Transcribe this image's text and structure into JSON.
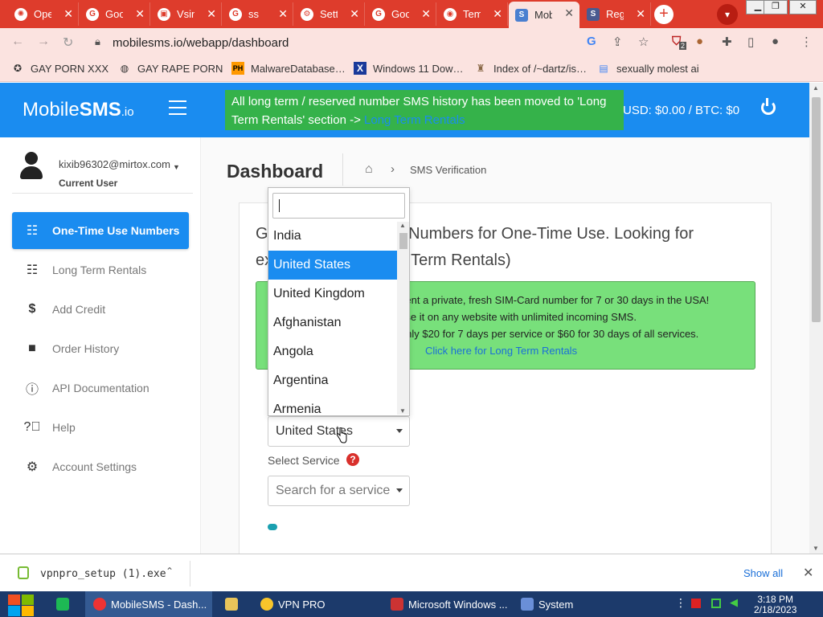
{
  "browser": {
    "tabs": [
      {
        "title": "Ope",
        "icon": "openai-icon"
      },
      {
        "title": "Goo",
        "icon": "google-icon"
      },
      {
        "title": "Vsin",
        "icon": "sim-icon"
      },
      {
        "title": "ss",
        "icon": "google-icon"
      },
      {
        "title": "Sett",
        "icon": "gear-icon"
      },
      {
        "title": "Goo",
        "icon": "google-icon"
      },
      {
        "title": "Tem",
        "icon": "globe-icon"
      },
      {
        "title": "Mob",
        "icon": "sms-icon"
      },
      {
        "title": "Reg",
        "icon": "sms-icon"
      }
    ],
    "active_tab_index": 7,
    "url": "mobilesms.io/webapp/dashboard",
    "extension_badge": "2",
    "bookmarks": [
      {
        "label": "GAY PORN XXX"
      },
      {
        "label": "GAY RAPE PORN"
      },
      {
        "label": "MalwareDatabase…",
        "icon_text": "PH"
      },
      {
        "label": "Windows 11 Dow…",
        "icon_text": "X"
      },
      {
        "label": "Index of /~dartz/is…"
      },
      {
        "label": "sexually molest ai"
      }
    ]
  },
  "app": {
    "logo_prefix": "Mobile",
    "logo_bold": "SMS",
    "logo_suffix": ".io",
    "notice_text": "All long term / reserved number SMS history has been moved to 'Long Term Rentals' section ->",
    "notice_link": "Long Term Rentals",
    "balance": "USD: $0.00  /  BTC: $0",
    "user": {
      "email": "kixib96302@mirtox.com",
      "role": "Current User"
    },
    "nav": [
      {
        "label": "One-Time Use Numbers",
        "icon": "list-check-icon",
        "active": true
      },
      {
        "label": "Long Term Rentals",
        "icon": "list-check-icon",
        "active": false
      },
      {
        "label": "Add Credit",
        "icon": "dollar-icon",
        "active": false
      },
      {
        "label": "Order History",
        "icon": "note-icon",
        "active": false
      },
      {
        "label": "API Documentation",
        "icon": "info-icon",
        "active": false
      },
      {
        "label": "Help",
        "icon": "question-icon",
        "active": false
      },
      {
        "label": "Account Settings",
        "icon": "gear-icon",
        "active": false
      }
    ],
    "page_title": "Dashboard",
    "breadcrumb": "SMS Verification",
    "card_heading": "Get SMS Verification Numbers for One-Time Use. Looking for extended use? (Long Term Rentals)",
    "promo_lines": [
      "Rent a private, fresh SIM-Card number for 7 or 30 days in the USA!",
      "Use it on any website with unlimited incoming SMS.",
      "Only $20 for 7 days per service or $60 for 30 days of all services."
    ],
    "promo_link": "Click here for Long Term Rentals",
    "country_selected": "United States",
    "service_label": "Select Service",
    "service_placeholder": "Search for a service",
    "country_options": [
      "India",
      "United States",
      "United Kingdom",
      "Afghanistan",
      "Angola",
      "Argentina",
      "Armenia"
    ],
    "country_selected_index": 1
  },
  "downloads": {
    "file": "vpnpro_setup (1).exe",
    "show_all": "Show all"
  },
  "taskbar": {
    "items": [
      {
        "label": "MobileSMS - Dash...",
        "active": true
      },
      {
        "label": "",
        "active": false
      },
      {
        "label": "VPN PRO",
        "active": false
      },
      {
        "label": "Microsoft Windows ...",
        "active": false
      },
      {
        "label": "System",
        "active": false
      }
    ],
    "time": "3:18 PM",
    "date": "2/18/2023"
  },
  "colors": {
    "brand_blue": "#1a8cf0",
    "notice_green": "#35b24a",
    "promo_green": "#78e07b",
    "chrome_red": "#de3c2c"
  }
}
